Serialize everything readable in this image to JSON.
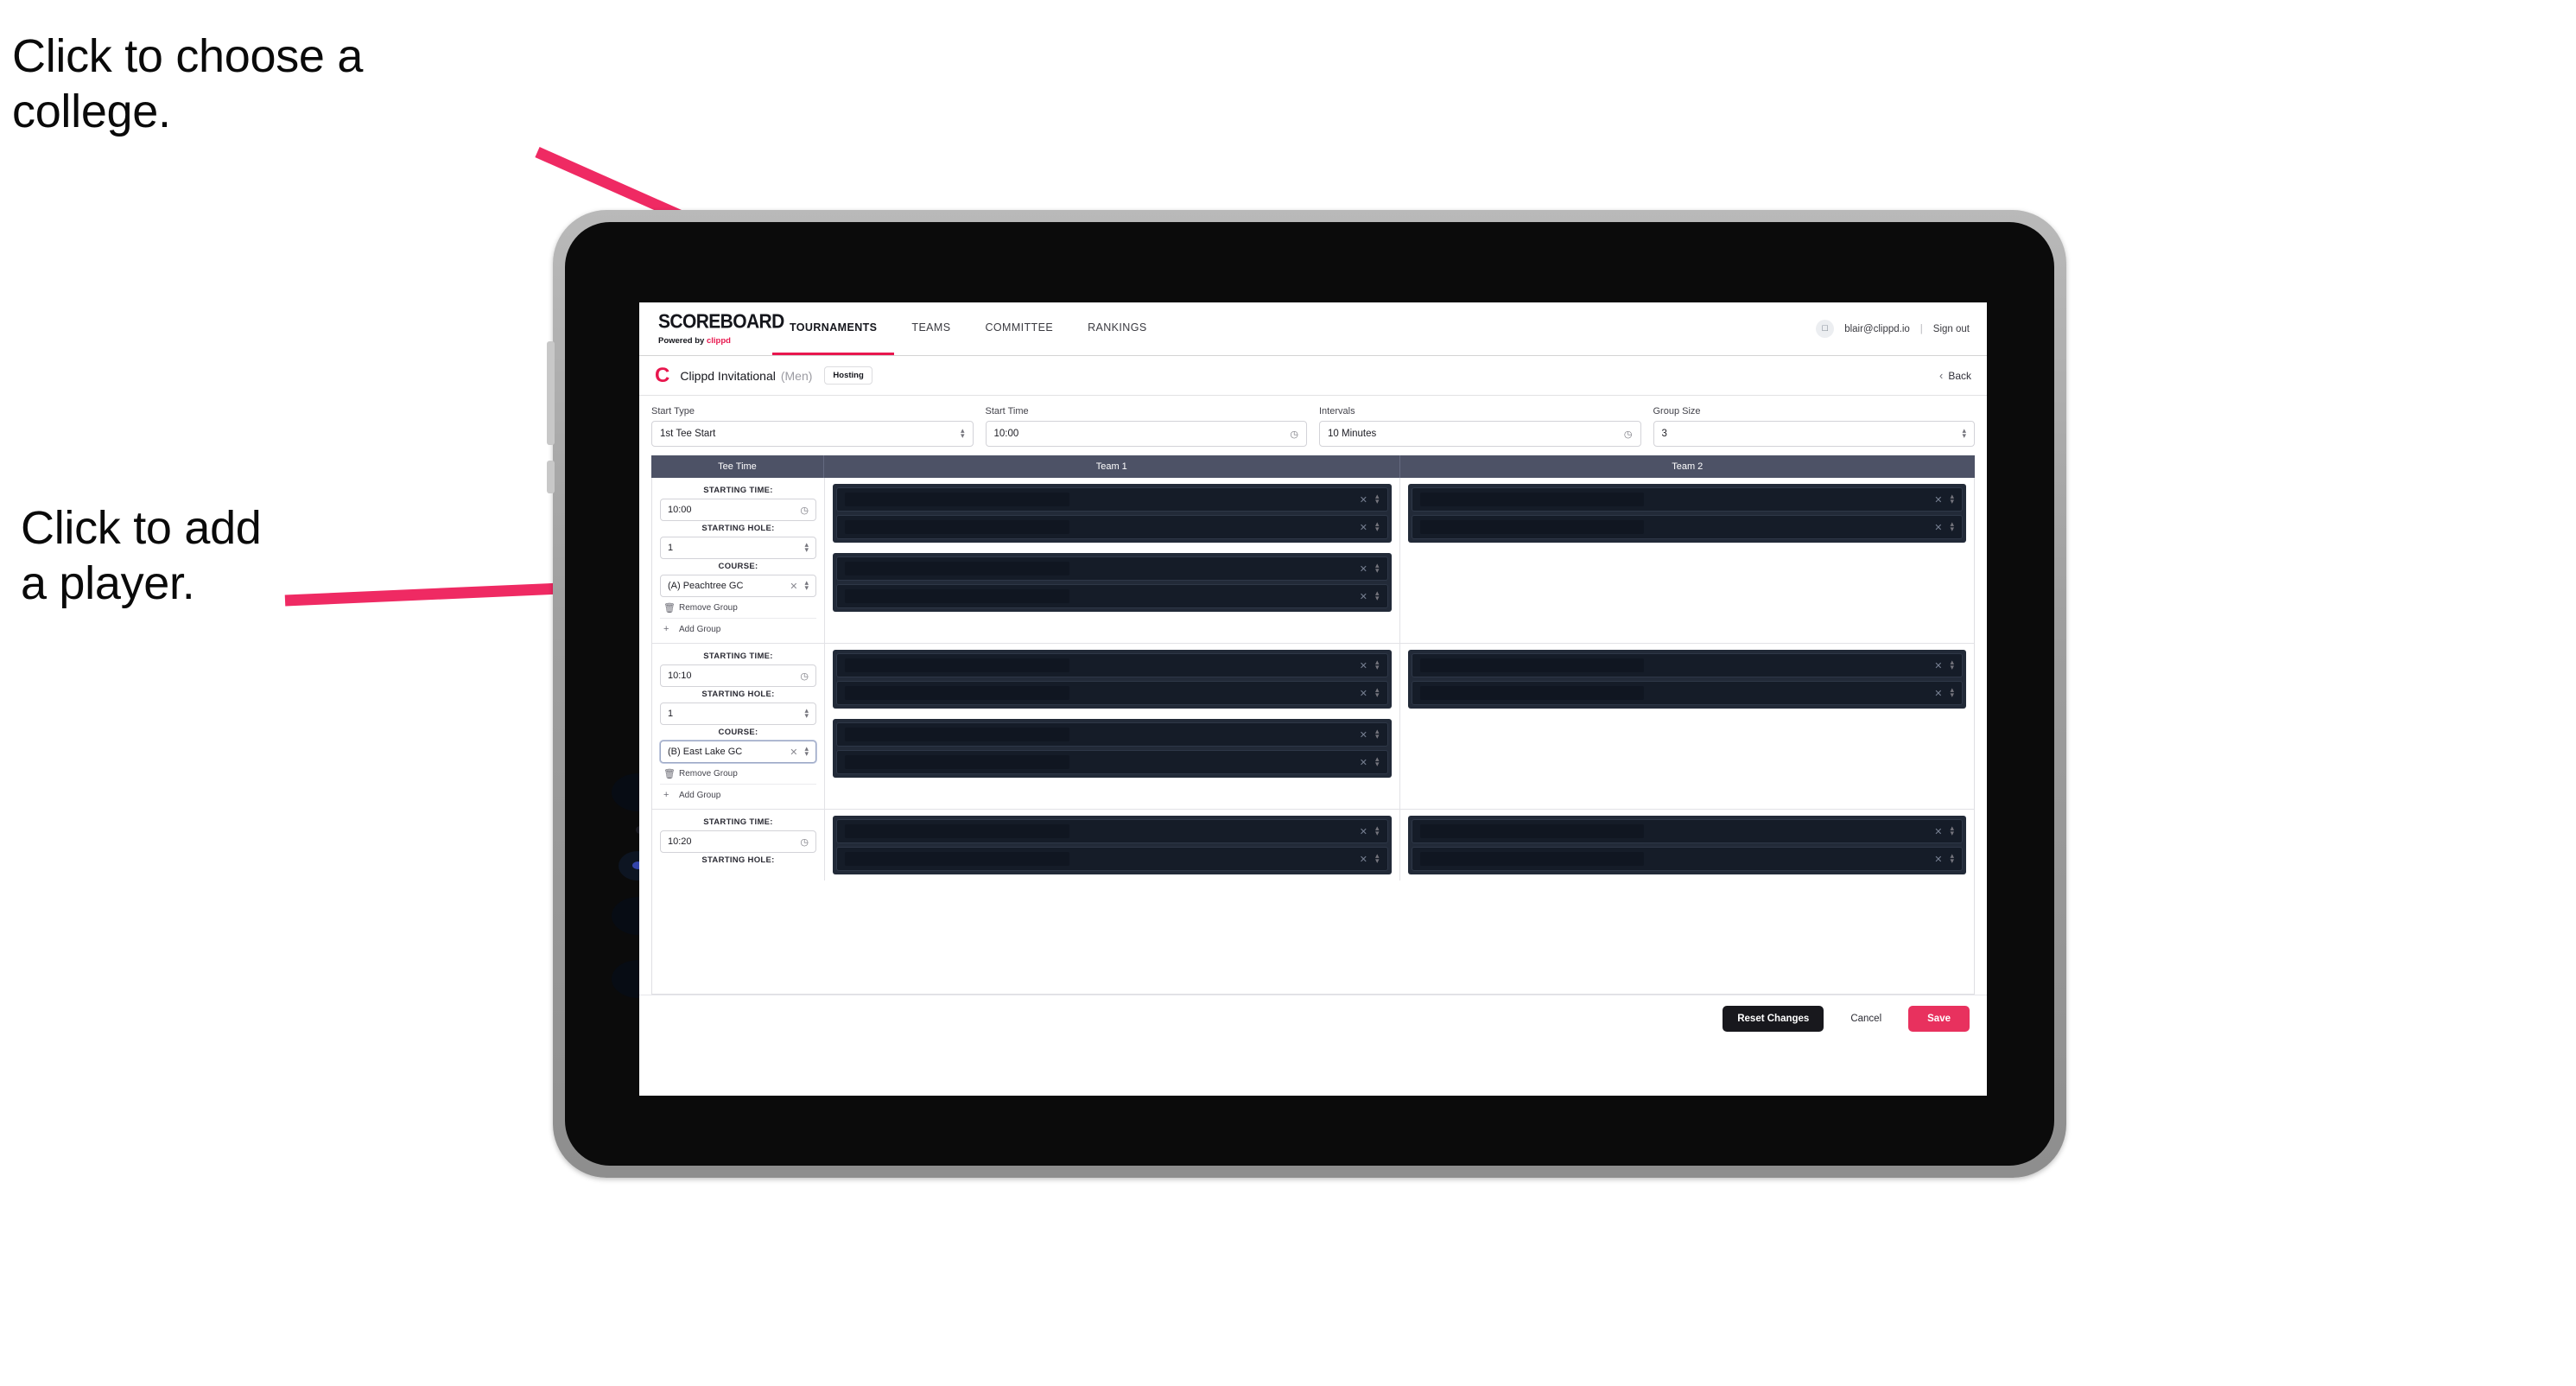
{
  "annotations": [
    {
      "id": "anno-college",
      "text": "Click to choose a\ncollege."
    },
    {
      "id": "anno-player",
      "text": "Click to add\na player."
    }
  ],
  "colors": {
    "accent_pink": "#e8174e",
    "save_pink": "#e8315e",
    "table_header": "#4d5266",
    "player_block": "#151c28",
    "arrow": "#ef2a63"
  },
  "nav": {
    "brand_title": "SCOREBOARD",
    "brand_sub_prefix": "Powered by ",
    "brand_sub_strong": "clippd",
    "links": [
      {
        "label": "TOURNAMENTS",
        "active": true
      },
      {
        "label": "TEAMS",
        "active": false
      },
      {
        "label": "COMMITTEE",
        "active": false
      },
      {
        "label": "RANKINGS",
        "active": false
      }
    ],
    "avatar_icon": "user-avatar-icon",
    "user_email": "blair@clippd.io",
    "separator": "|",
    "sign_out": "Sign out"
  },
  "subheader": {
    "logo_mark": "C",
    "tournament_name": "Clippd Invitational",
    "gender": "(Men)",
    "hosting_badge": "Hosting",
    "back_chevron": "‹",
    "back_label": "Back"
  },
  "controls": [
    {
      "label": "Start Type",
      "value": "1st Tee Start",
      "icon": "stepper-icon"
    },
    {
      "label": "Start Time",
      "value": "10:00",
      "icon": "clock-icon"
    },
    {
      "label": "Intervals",
      "value": "10 Minutes",
      "icon": "clock-icon"
    },
    {
      "label": "Group Size",
      "value": "3",
      "icon": "stepper-icon"
    }
  ],
  "table": {
    "headers": {
      "tee_time": "Tee Time",
      "team_1": "Team 1",
      "team_2": "Team 2"
    },
    "field_labels": {
      "starting_time": "STARTING TIME:",
      "starting_hole": "STARTING HOLE:",
      "course": "COURSE:"
    },
    "actions": {
      "remove_group": "Remove Group",
      "add_group": "Add Group"
    },
    "groups": [
      {
        "starting_time": "10:00",
        "starting_hole": "1",
        "course": "(A) Peachtree GC",
        "course_focused": false,
        "team1_blocks": [
          2,
          2
        ],
        "team2_blocks": [
          2
        ]
      },
      {
        "starting_time": "10:10",
        "starting_hole": "1",
        "course": "(B) East Lake GC",
        "course_focused": true,
        "team1_blocks": [
          2,
          2
        ],
        "team2_blocks": [
          2
        ]
      },
      {
        "starting_time": "10:20",
        "starting_hole": "",
        "course": "",
        "course_focused": false,
        "team1_blocks": [
          2
        ],
        "team2_blocks": [
          2
        ]
      }
    ]
  },
  "footer": {
    "reset": "Reset Changes",
    "cancel": "Cancel",
    "save": "Save"
  }
}
